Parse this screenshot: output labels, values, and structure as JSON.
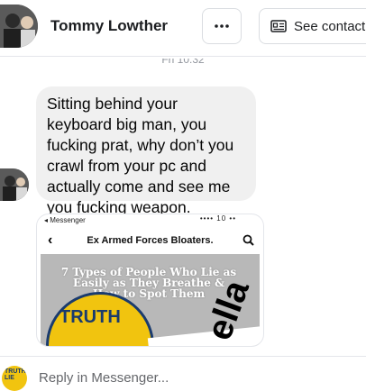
{
  "header": {
    "contact_name": "Tommy Lowther",
    "more_icon": "more-horizontal-icon",
    "see_contact_label": "See contact",
    "see_contact_icon": "contact-card-icon"
  },
  "thread": {
    "timestamp": "Fri 10:32",
    "message_text": "Sitting behind your keyboard big man, you fucking prat, why don’t you crawl from your pc and actually come and see me you fucking weapon."
  },
  "attachment": {
    "status_label": "◂ Messenger",
    "status_icons": "•••• 10 ••",
    "page_title": "Ex Armed Forces Bloaters.",
    "headline": "7 Types of People Who Lie as Easily as They Breathe & How to Spot Them",
    "badge_text": "TRUTH",
    "overlay_text": "ella"
  },
  "reply": {
    "placeholder": "Reply in Messenger...",
    "avatar_text": "TRUTH LIE"
  },
  "colors": {
    "bubble_bg": "#f0f0f0",
    "border": "#e4e6eb",
    "badge_yellow": "#f1c40f",
    "badge_blue": "#1a3b6e",
    "muted_text": "#65676b"
  }
}
